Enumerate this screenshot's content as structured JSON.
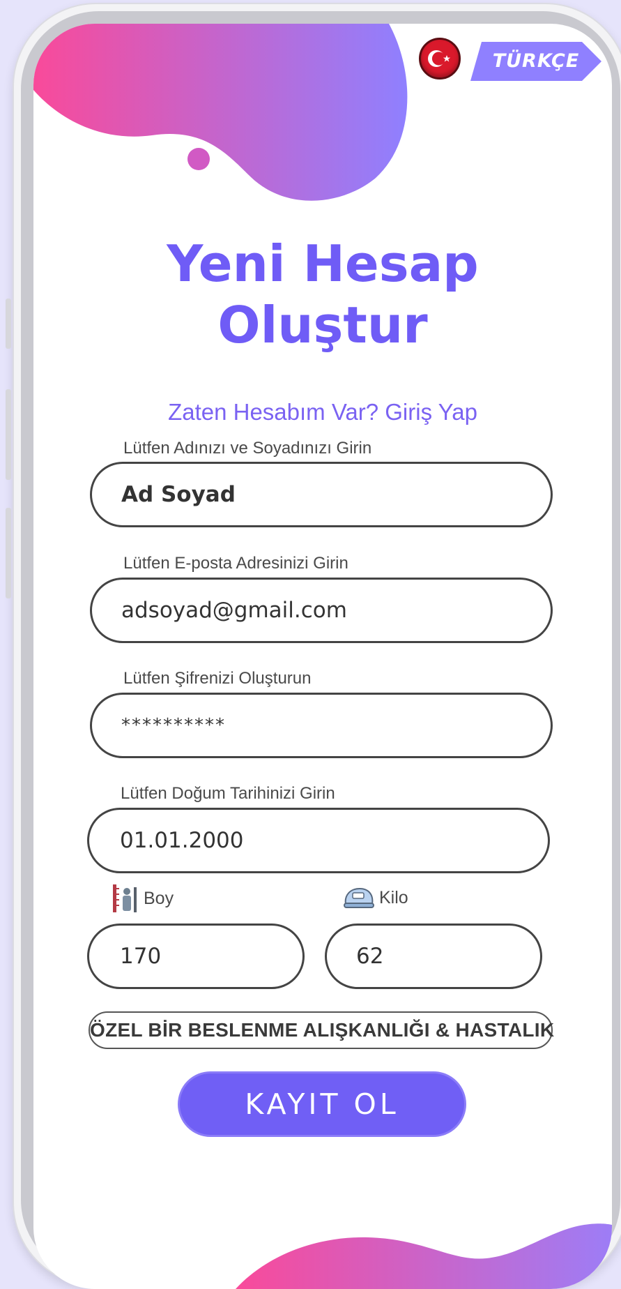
{
  "language": {
    "label": "TÜRKÇE",
    "flag_icon": "turkey-flag-icon"
  },
  "header": {
    "title_line1": "Yeni Hesap",
    "title_line2": "Oluştur",
    "login_link": "Zaten Hesabım Var? Giriş Yap"
  },
  "form": {
    "name": {
      "label": "Lütfen Adınızı ve Soyadınızı Girin",
      "value": "Ad Soyad"
    },
    "email": {
      "label": "Lütfen E-posta Adresinizi Girin",
      "value": "adsoyad@gmail.com"
    },
    "password": {
      "label": "Lütfen Şifrenizi Oluşturun",
      "value": "**********"
    },
    "birthdate": {
      "label": "Lütfen Doğum Tarihinizi Girin",
      "value": "01.01.2000"
    },
    "height": {
      "label": "Boy",
      "value": "170",
      "icon": "height-measure-icon"
    },
    "weight": {
      "label": "Kilo",
      "value": "62",
      "icon": "scale-icon"
    }
  },
  "actions": {
    "special_diet_label": "ÖZEL BİR BESLENME ALIŞKANLIĞI & HASTALIK",
    "register_label": "KAYIT OL"
  },
  "colors": {
    "accent": "#705ff5",
    "title": "#6f5cf6",
    "gradient_start": "#f94a9a",
    "gradient_end": "#8f80ff"
  }
}
